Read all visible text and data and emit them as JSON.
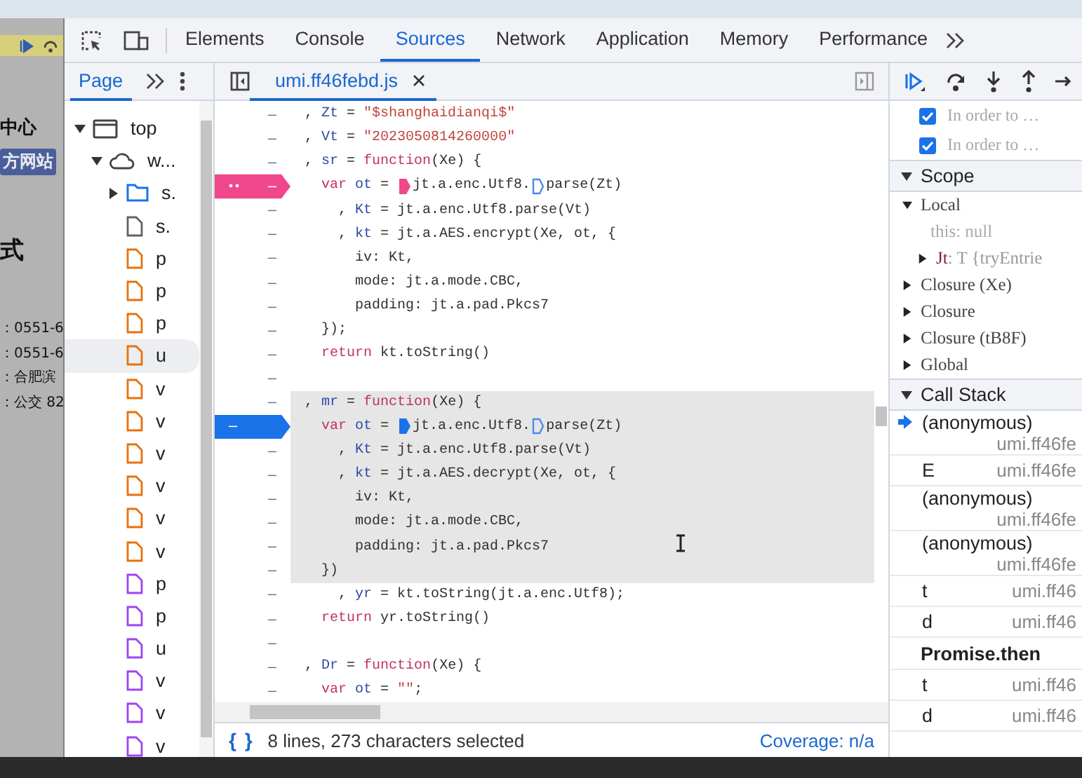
{
  "page_behind": {
    "items": [
      {
        "text": "中心",
        "kind": "heading"
      },
      {
        "text": "方网站",
        "kind": "badge"
      },
      {
        "text": "式",
        "kind": "title"
      },
      {
        "text": "：0551-6",
        "kind": "info"
      },
      {
        "text": "：0551-6",
        "kind": "info"
      },
      {
        "text": "：合肥滨",
        "kind": "info"
      },
      {
        "text": "：公交 82",
        "kind": "info"
      }
    ]
  },
  "devtools_tabs": [
    {
      "label": "Elements",
      "selected": false
    },
    {
      "label": "Console",
      "selected": false
    },
    {
      "label": "Sources",
      "selected": true
    },
    {
      "label": "Network",
      "selected": false
    },
    {
      "label": "Application",
      "selected": false
    },
    {
      "label": "Memory",
      "selected": false
    },
    {
      "label": "Performance",
      "selected": false
    }
  ],
  "navigator": {
    "tabs": [
      {
        "label": "Page",
        "selected": true
      }
    ],
    "tree": [
      {
        "label": "top",
        "kind": "frame",
        "expanded": true,
        "selected": false,
        "children": [
          {
            "label": "w...",
            "kind": "origin",
            "expanded": true,
            "selected": false,
            "children": [
              {
                "label": "s.",
                "kind": "folder",
                "expanded": false,
                "selected": false
              },
              {
                "label": "s.",
                "kind": "document",
                "selected": false
              },
              {
                "label": "p",
                "kind": "script",
                "selected": false
              },
              {
                "label": "p",
                "kind": "script",
                "selected": false
              },
              {
                "label": "p",
                "kind": "script",
                "selected": false
              },
              {
                "label": "u",
                "kind": "script",
                "selected": true
              },
              {
                "label": "v",
                "kind": "script",
                "selected": false
              },
              {
                "label": "v",
                "kind": "script",
                "selected": false
              },
              {
                "label": "v",
                "kind": "script",
                "selected": false
              },
              {
                "label": "v",
                "kind": "script",
                "selected": false
              },
              {
                "label": "v",
                "kind": "script",
                "selected": false
              },
              {
                "label": "v",
                "kind": "script",
                "selected": false
              },
              {
                "label": "p",
                "kind": "fetch",
                "selected": false
              },
              {
                "label": "p",
                "kind": "fetch",
                "selected": false
              },
              {
                "label": "u",
                "kind": "fetch",
                "selected": false
              },
              {
                "label": "v",
                "kind": "fetch",
                "selected": false
              },
              {
                "label": "v",
                "kind": "fetch",
                "selected": false
              },
              {
                "label": "v",
                "kind": "fetch",
                "selected": false
              }
            ]
          }
        ]
      }
    ]
  },
  "editor": {
    "tabs": [
      {
        "label": "umi.ff46febd.js",
        "selected": true
      }
    ],
    "lines": [
      {
        "gutter": "–",
        "kind": "code",
        "selected": false,
        "tokens": [
          {
            "text": " , ",
            "kind": "plain"
          },
          {
            "text": "Zt",
            "kind": "name"
          },
          {
            "text": " = ",
            "kind": "plain"
          },
          {
            "text": "\"$shanghaidianqi$\"",
            "kind": "string"
          }
        ]
      },
      {
        "gutter": "–",
        "kind": "code",
        "selected": false,
        "tokens": [
          {
            "text": " , ",
            "kind": "plain"
          },
          {
            "text": "Vt",
            "kind": "name"
          },
          {
            "text": " = ",
            "kind": "plain"
          },
          {
            "text": "\"2023050814260000\"",
            "kind": "string"
          }
        ]
      },
      {
        "gutter": "–",
        "kind": "code",
        "selected": false,
        "tokens": [
          {
            "text": " , ",
            "kind": "plain"
          },
          {
            "text": "sr",
            "kind": "name"
          },
          {
            "text": " = ",
            "kind": "plain"
          },
          {
            "text": "function",
            "kind": "keyword"
          },
          {
            "text": "(Xe) {",
            "kind": "plain"
          }
        ]
      },
      {
        "gutter": "–",
        "kind": "logpoint",
        "selected": false,
        "tokens": [
          {
            "text": "   var",
            "kind": "keyword"
          },
          {
            "text": " ot",
            "kind": "name"
          },
          {
            "text": " = ",
            "kind": "plain"
          },
          {
            "kind": "marker",
            "active": true
          },
          {
            "text": "jt.a.enc.Utf8.",
            "kind": "plain"
          },
          {
            "kind": "marker",
            "active": false
          },
          {
            "text": "parse(Zt)",
            "kind": "plain"
          }
        ]
      },
      {
        "gutter": "–",
        "kind": "code",
        "selected": false,
        "tokens": [
          {
            "text": "     , ",
            "kind": "plain"
          },
          {
            "text": "Kt",
            "kind": "name"
          },
          {
            "text": " = jt.a.enc.Utf8.parse(Vt)",
            "kind": "plain"
          }
        ]
      },
      {
        "gutter": "–",
        "kind": "code",
        "selected": false,
        "tokens": [
          {
            "text": "     , ",
            "kind": "plain"
          },
          {
            "text": "kt",
            "kind": "name"
          },
          {
            "text": " = jt.a.AES.encrypt(Xe, ot, {",
            "kind": "plain"
          }
        ]
      },
      {
        "gutter": "–",
        "kind": "code",
        "selected": false,
        "tokens": [
          {
            "text": "       iv: Kt,",
            "kind": "plain"
          }
        ]
      },
      {
        "gutter": "–",
        "kind": "code",
        "selected": false,
        "tokens": [
          {
            "text": "       mode: jt.a.mode.CBC,",
            "kind": "plain"
          }
        ]
      },
      {
        "gutter": "–",
        "kind": "code",
        "selected": false,
        "tokens": [
          {
            "text": "       padding: jt.a.pad.Pkcs7",
            "kind": "plain"
          }
        ]
      },
      {
        "gutter": "–",
        "kind": "code",
        "selected": false,
        "tokens": [
          {
            "text": "   });",
            "kind": "plain"
          }
        ]
      },
      {
        "gutter": "–",
        "kind": "code",
        "selected": false,
        "tokens": [
          {
            "text": "   return",
            "kind": "keyword"
          },
          {
            "text": " kt.toString()",
            "kind": "plain"
          }
        ]
      },
      {
        "gutter": "–",
        "kind": "code",
        "selected": false
      },
      {
        "gutter": "–",
        "kind": "code",
        "selected": true,
        "tokens": [
          {
            "text": " , ",
            "kind": "plain"
          },
          {
            "text": "mr",
            "kind": "name"
          },
          {
            "text": " = ",
            "kind": "plain"
          },
          {
            "text": "function",
            "kind": "keyword"
          },
          {
            "text": "(Xe) {",
            "kind": "plain"
          }
        ]
      },
      {
        "gutter": "–",
        "kind": "breakpoint",
        "selected": true,
        "tokens": [
          {
            "text": "   var",
            "kind": "keyword"
          },
          {
            "text": " ot",
            "kind": "name"
          },
          {
            "text": " = ",
            "kind": "plain"
          },
          {
            "kind": "marker",
            "active": true
          },
          {
            "text": "jt.a.enc.Utf8.",
            "kind": "plain"
          },
          {
            "kind": "marker",
            "active": false
          },
          {
            "text": "parse(Zt)",
            "kind": "plain"
          }
        ]
      },
      {
        "gutter": "–",
        "kind": "code",
        "selected": true,
        "tokens": [
          {
            "text": "     , ",
            "kind": "plain"
          },
          {
            "text": "Kt",
            "kind": "name"
          },
          {
            "text": " = jt.a.enc.Utf8.parse(Vt)",
            "kind": "plain"
          }
        ]
      },
      {
        "gutter": "–",
        "kind": "code",
        "selected": true,
        "tokens": [
          {
            "text": "     , ",
            "kind": "plain"
          },
          {
            "text": "kt",
            "kind": "name"
          },
          {
            "text": " = jt.a.AES.decrypt(Xe, ot, {",
            "kind": "plain"
          }
        ]
      },
      {
        "gutter": "–",
        "kind": "code",
        "selected": true,
        "tokens": [
          {
            "text": "       iv: Kt,",
            "kind": "plain"
          }
        ]
      },
      {
        "gutter": "–",
        "kind": "code",
        "selected": true,
        "tokens": [
          {
            "text": "       mode: jt.a.mode.CBC,",
            "kind": "plain"
          }
        ]
      },
      {
        "gutter": "–",
        "kind": "code",
        "selected": true,
        "tokens": [
          {
            "text": "       padding: jt.a.pad.Pkcs7",
            "kind": "plain"
          }
        ]
      },
      {
        "gutter": "–",
        "kind": "code",
        "selected": true,
        "tokens": [
          {
            "text": "   })",
            "kind": "plain"
          }
        ]
      },
      {
        "gutter": "–",
        "kind": "code",
        "selected": false,
        "tokens": [
          {
            "text": "     , ",
            "kind": "plain"
          },
          {
            "text": "yr",
            "kind": "name"
          },
          {
            "text": " = kt.toString(jt.a.enc.Utf8);",
            "kind": "plain"
          }
        ]
      },
      {
        "gutter": "–",
        "kind": "code",
        "selected": false,
        "tokens": [
          {
            "text": "   return",
            "kind": "keyword"
          },
          {
            "text": " yr.toString()",
            "kind": "plain"
          }
        ]
      },
      {
        "gutter": "–",
        "kind": "code",
        "selected": false
      },
      {
        "gutter": "–",
        "kind": "code",
        "selected": false,
        "tokens": [
          {
            "text": " , ",
            "kind": "plain"
          },
          {
            "text": "Dr",
            "kind": "name"
          },
          {
            "text": " = ",
            "kind": "plain"
          },
          {
            "text": "function",
            "kind": "keyword"
          },
          {
            "text": "(Xe) {",
            "kind": "plain"
          }
        ]
      },
      {
        "gutter": "–",
        "kind": "code",
        "selected": false,
        "tokens": [
          {
            "text": "   var",
            "kind": "keyword"
          },
          {
            "text": " ot",
            "kind": "name"
          },
          {
            "text": " = ",
            "kind": "plain"
          },
          {
            "text": "\"\"",
            "kind": "string"
          },
          {
            "text": ";",
            "kind": "plain"
          }
        ]
      }
    ],
    "status_bar": {
      "pretty_print": "{ }",
      "selection": "8 lines, 273 characters selected",
      "coverage": "Coverage: n/a"
    }
  },
  "sidebar": {
    "breakpoints": [
      {
        "label": "In order to …",
        "checked": true
      },
      {
        "label": "In order to …",
        "checked": true
      }
    ],
    "scope": {
      "title": "Scope",
      "expanded": true,
      "items": [
        {
          "label": "Local",
          "expanded": true,
          "children": [
            {
              "kind": "value",
              "name": "this",
              "value": ": null"
            },
            {
              "kind": "object",
              "name": "Jt",
              "value": ": T  {tryEntrie",
              "expanded": false
            }
          ]
        },
        {
          "label": "Closure (Xe)",
          "expanded": false
        },
        {
          "label": "Closure",
          "expanded": false
        },
        {
          "label": "Closure (tB8F)",
          "expanded": false
        },
        {
          "label": "Global",
          "expanded": false
        }
      ]
    },
    "call_stack": {
      "title": "Call Stack",
      "expanded": true,
      "frames": [
        {
          "kind": "frame",
          "name": "(anonymous)",
          "location": "umi.ff46fe",
          "current": true
        },
        {
          "kind": "frame",
          "name": "E",
          "location": "umi.ff46fe",
          "current": false
        },
        {
          "kind": "frame",
          "name": "(anonymous)",
          "location": "umi.ff46fe",
          "current": false
        },
        {
          "kind": "frame",
          "name": "(anonymous)",
          "location": "umi.ff46fe",
          "current": false
        },
        {
          "kind": "frame",
          "name": "t",
          "location": "umi.ff46",
          "current": false
        },
        {
          "kind": "frame",
          "name": "d",
          "location": "umi.ff46",
          "current": false
        },
        {
          "kind": "async",
          "name": "Promise.then"
        },
        {
          "kind": "frame",
          "name": "t",
          "location": "umi.ff46",
          "current": false
        },
        {
          "kind": "frame",
          "name": "d",
          "location": "umi.ff46",
          "current": false
        }
      ]
    }
  }
}
